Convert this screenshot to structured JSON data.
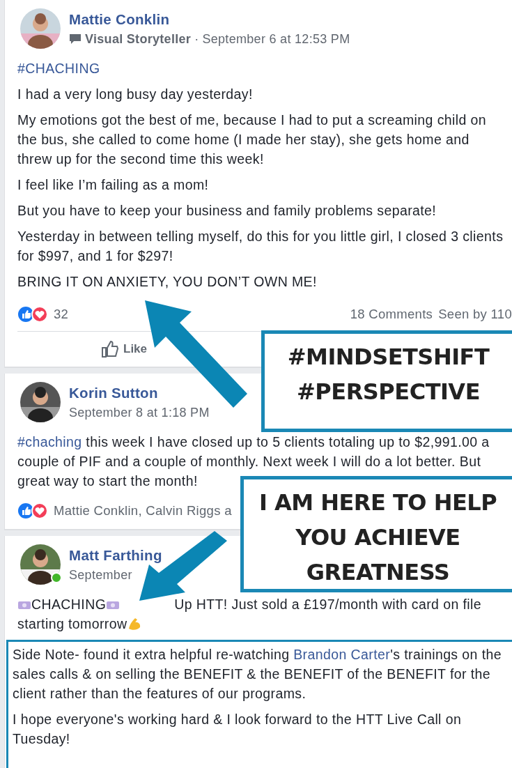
{
  "posts": [
    {
      "author": "Mattie Conklin",
      "badge": "Visual Storyteller",
      "separator": "·",
      "time": "September 6 at 12:53 PM",
      "paragraphs": [
        {
          "segments": [
            {
              "text": "#CHACHING",
              "kind": "link"
            }
          ]
        },
        {
          "segments": [
            {
              "text": "I had a very long busy day yesterday!",
              "kind": "text"
            }
          ]
        },
        {
          "segments": [
            {
              "text": "My emotions got the best of me, because I had to put a screaming child on the bus, she called to come home (I made her stay), she gets home and threw up for the second time this week!",
              "kind": "text"
            }
          ]
        },
        {
          "segments": [
            {
              "text": "I feel like I’m failing as a mom!",
              "kind": "text"
            }
          ]
        },
        {
          "segments": [
            {
              "text": "But you have to keep your business and family problems separate!",
              "kind": "text"
            }
          ]
        },
        {
          "segments": [
            {
              "text": "Yesterday in between telling myself, do this for you little girl, I closed 3 clients for $997, and 1 for $297!",
              "kind": "text"
            }
          ]
        },
        {
          "segments": [
            {
              "text": "BRING IT ON ANXIETY, YOU DON’T OWN ME!",
              "kind": "text"
            }
          ]
        }
      ],
      "reactions": "32",
      "stats": [
        "18 Comments",
        "Seen by 110"
      ],
      "actions": [
        "Like"
      ]
    },
    {
      "author": "Korin Sutton",
      "time": "September 8 at 1:18 PM",
      "paragraphs": [
        {
          "segments": [
            {
              "text": "#chaching",
              "kind": "link"
            },
            {
              "text": " this week I have closed up to 5 clients totaling up to $2,991.00 a couple of PIF and a couple of monthly. Next week I will do a lot better. But great way to start the month!",
              "kind": "text"
            }
          ]
        }
      ],
      "reactions": "Mattie Conklin, Calvin Riggs a"
    },
    {
      "author": "Matt Farthing",
      "time": "September",
      "online": true,
      "paragraphs": [
        {
          "segments": [
            {
              "text": "CHACHING",
              "kind": "money"
            },
            {
              "text": "Up HTT! Just sold a £197/month with card on file starting tomorrow",
              "kind": "flex"
            }
          ]
        }
      ],
      "boxed_paragraphs": [
        {
          "segments": [
            {
              "text": "Side Note- found it extra helpful re-watching ",
              "kind": "text"
            },
            {
              "text": "Brandon Carter",
              "kind": "link"
            },
            {
              "text": "'s trainings on the sales calls & on selling the BENEFIT & the BENEFIT of the BENEFIT for the client rather than the features of our programs.",
              "kind": "text"
            }
          ]
        },
        {
          "segments": [
            {
              "text": "I hope everyone's working hard & I look forward to the HTT Live Call on Tuesday!",
              "kind": "text"
            }
          ]
        }
      ]
    }
  ],
  "callouts": [
    {
      "lines": [
        "#MINDSETSHIFT",
        "#PERSPECTIVE"
      ]
    },
    {
      "lines": [
        "I AM HERE TO HELP",
        "YOU ACHIEVE",
        "GREATNESS"
      ]
    }
  ]
}
